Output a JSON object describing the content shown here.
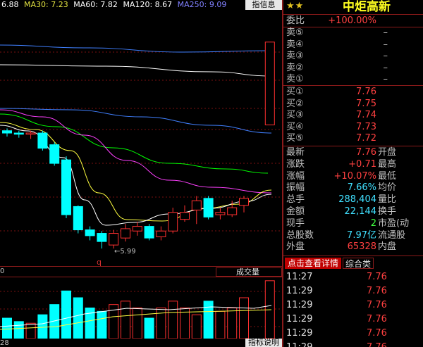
{
  "ma_legend": [
    {
      "label": "6.88",
      "color": "#ffffff"
    },
    {
      "label": "MA30: 7.23",
      "color": "#e0e040"
    },
    {
      "label": "MA60: 7.82",
      "color": "#ffffff"
    },
    {
      "label": "MA120: 8.67",
      "color": "#ffffff"
    },
    {
      "label": "MA250: 9.09",
      "color": "#8080ff"
    }
  ],
  "ma_tag": "指信息",
  "low_label": "←5.99",
  "q_mark": "q",
  "vol_zero": "0",
  "vol_label": "成交量",
  "vol_footer_left": "28",
  "indicator_button": "指标说明",
  "panel": {
    "stars": "★★",
    "name": "中炬高新",
    "weibi": {
      "label": "委比",
      "value": "+100.00%"
    },
    "sells": [
      {
        "label": "卖⑤",
        "value": "–"
      },
      {
        "label": "卖④",
        "value": "–"
      },
      {
        "label": "卖③",
        "value": "–"
      },
      {
        "label": "卖②",
        "value": "–"
      },
      {
        "label": "卖①",
        "value": "–"
      }
    ],
    "buys": [
      {
        "label": "买①",
        "value": "7.76"
      },
      {
        "label": "买②",
        "value": "7.75"
      },
      {
        "label": "买③",
        "value": "7.74"
      },
      {
        "label": "买④",
        "value": "7.73"
      },
      {
        "label": "买⑤",
        "value": "7.72"
      }
    ],
    "quotes": [
      {
        "label": "最新",
        "value": "7.76",
        "color": "red",
        "label2": "开盘"
      },
      {
        "label": "涨跌",
        "value": "+0.71",
        "color": "red",
        "label2": "最高"
      },
      {
        "label": "涨幅",
        "value": "+10.07%",
        "color": "red",
        "label2": "最低"
      },
      {
        "label": "振幅",
        "value": "7.66%",
        "color": "cyan",
        "label2": "均价"
      },
      {
        "label": "总手",
        "value": "288,404",
        "color": "cyan",
        "label2": "量比"
      },
      {
        "label": "金额",
        "value": "22,144",
        "color": "cyan",
        "label2": "换手"
      },
      {
        "label": "现手",
        "value": "2",
        "color": "green",
        "label2": "市盈(动"
      },
      {
        "label": "总股数",
        "value": "7.97亿",
        "color": "cyan",
        "label2": "流通股"
      },
      {
        "label": "外盘",
        "value": "65328",
        "color": "red",
        "label2": "内盘"
      }
    ],
    "tab_detail": "点击查看详情",
    "tab_summary": "综合类",
    "ticks": [
      {
        "time": "11:27",
        "price": "7.76"
      },
      {
        "time": "11:29",
        "price": "7.76"
      },
      {
        "time": "11:29",
        "price": "7.76"
      },
      {
        "time": "11:29",
        "price": "7.76"
      },
      {
        "time": "11:29",
        "price": "7.76"
      },
      {
        "time": "11:29",
        "price": "7.76"
      }
    ]
  },
  "colors": {
    "up": "#ff3030",
    "down": "#00ffff",
    "ma5": "#ffffff",
    "ma10": "#ffff40",
    "ma20": "#ff40ff",
    "ma60": "#00ff00",
    "ma120": "#ffffff",
    "ma250": "#4080ff"
  },
  "chart_data": {
    "type": "candlestick",
    "candles": [
      {
        "o": 7.0,
        "c": 6.98,
        "h": 7.02,
        "l": 6.95
      },
      {
        "o": 6.98,
        "c": 6.97,
        "h": 7.0,
        "l": 6.94
      },
      {
        "o": 6.97,
        "c": 6.98,
        "h": 7.0,
        "l": 6.93
      },
      {
        "o": 6.98,
        "c": 6.85,
        "h": 7.0,
        "l": 6.83
      },
      {
        "o": 6.88,
        "c": 6.72,
        "h": 6.9,
        "l": 6.7
      },
      {
        "o": 6.75,
        "c": 6.28,
        "h": 6.78,
        "l": 6.25
      },
      {
        "o": 6.35,
        "c": 6.15,
        "h": 6.36,
        "l": 6.12
      },
      {
        "o": 6.15,
        "c": 6.1,
        "h": 6.18,
        "l": 6.06
      },
      {
        "o": 6.12,
        "c": 6.05,
        "h": 6.14,
        "l": 5.99
      },
      {
        "o": 6.02,
        "c": 6.12,
        "h": 6.15,
        "l": 5.99
      },
      {
        "o": 6.08,
        "c": 6.16,
        "h": 6.2,
        "l": 6.05
      },
      {
        "o": 6.14,
        "c": 6.18,
        "h": 6.22,
        "l": 6.1
      },
      {
        "o": 6.18,
        "c": 6.08,
        "h": 6.2,
        "l": 6.06
      },
      {
        "o": 6.09,
        "c": 6.14,
        "h": 6.18,
        "l": 6.06
      },
      {
        "o": 6.14,
        "c": 6.3,
        "h": 6.34,
        "l": 6.12
      },
      {
        "o": 6.24,
        "c": 6.3,
        "h": 6.36,
        "l": 6.22
      },
      {
        "o": 6.32,
        "c": 6.4,
        "h": 6.44,
        "l": 6.2
      },
      {
        "o": 6.42,
        "c": 6.26,
        "h": 6.44,
        "l": 6.24
      },
      {
        "o": 6.28,
        "c": 6.3,
        "h": 6.34,
        "l": 6.24
      },
      {
        "o": 6.28,
        "c": 6.34,
        "h": 6.4,
        "l": 6.26
      },
      {
        "o": 6.36,
        "c": 6.42,
        "h": 6.44,
        "l": 6.3
      },
      {
        "o": 7.05,
        "c": 7.76,
        "h": 7.76,
        "l": 7.05
      }
    ],
    "price_range": [
      5.9,
      8.0
    ],
    "volumes": [
      12,
      10,
      9,
      14,
      20,
      28,
      24,
      18,
      16,
      20,
      22,
      18,
      12,
      18,
      22,
      18,
      14,
      22,
      16,
      18,
      24,
      34
    ],
    "volume_up": [
      false,
      false,
      true,
      false,
      false,
      false,
      false,
      false,
      false,
      true,
      true,
      true,
      false,
      true,
      true,
      true,
      true,
      false,
      true,
      true,
      true,
      true
    ],
    "volume_range": [
      0,
      36
    ]
  }
}
